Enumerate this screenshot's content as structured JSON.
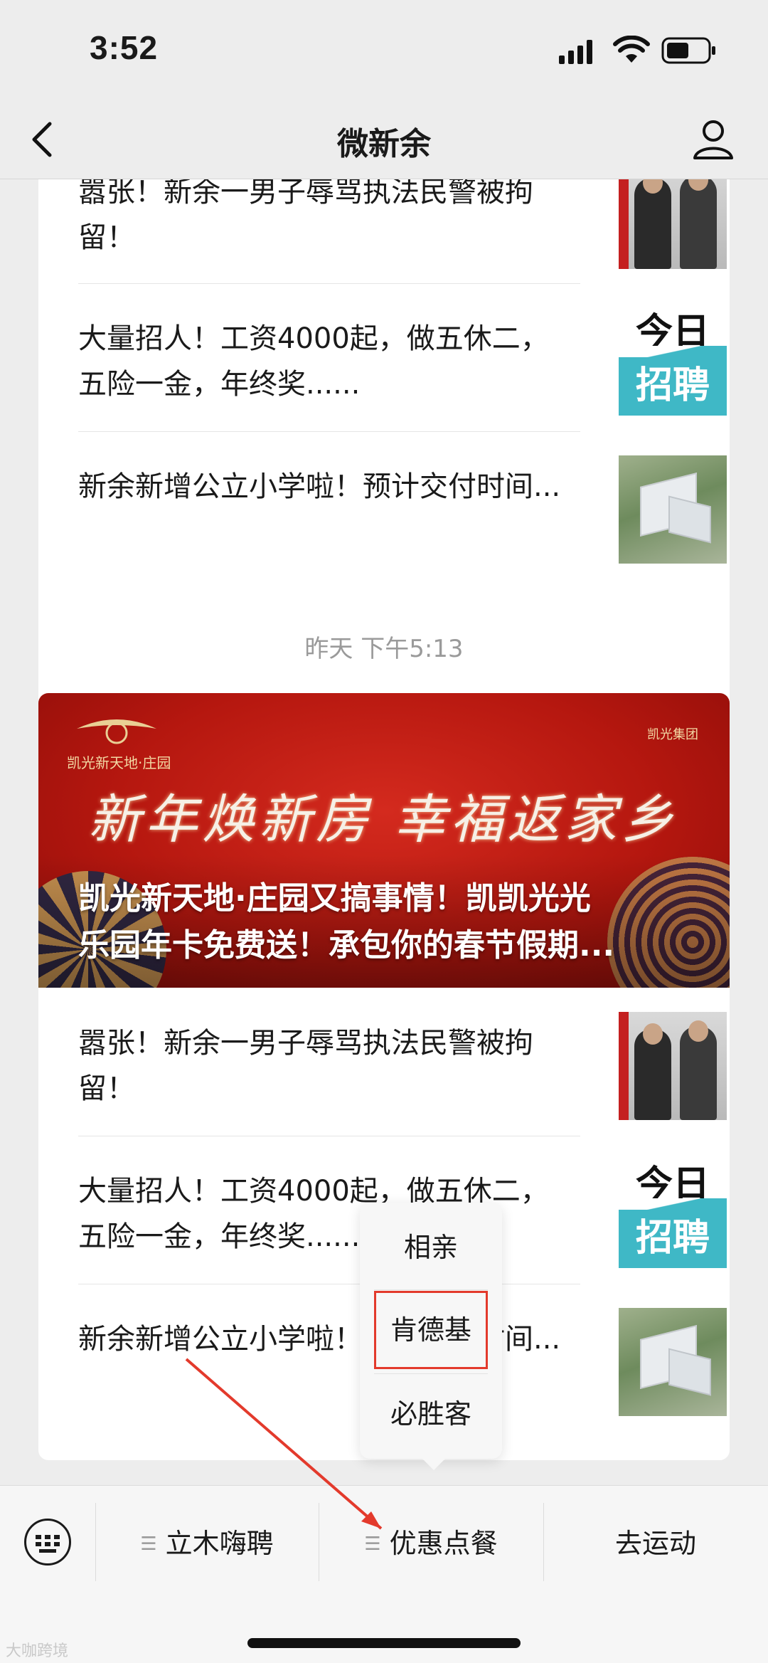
{
  "status_bar": {
    "time": "3:52"
  },
  "nav": {
    "title": "微新余"
  },
  "feed": {
    "card_a": {
      "items": [
        {
          "title": "嚣张！新余一男子辱骂执法民警被拘留！",
          "thumb": "police"
        },
        {
          "title": "大量招人！工资4000起，做五休二，五险一金，年终奖......",
          "thumb": "job"
        },
        {
          "title": "新余新增公立小学啦！预计交付时间...",
          "thumb": "school"
        }
      ]
    },
    "timestamp": "昨天 下午5:13",
    "card_b": {
      "banner": {
        "logo_text": "凯光新天地·庄园",
        "corp_text": "凯光集团",
        "slogan": "新年焕新房 幸福返家乡",
        "headline_line1": "凯光新天地·庄园又搞事情！凯凯光光",
        "headline_line2": "乐园年卡免费送！承包你的春节假期..."
      },
      "items": [
        {
          "title": "嚣张！新余一男子辱骂执法民警被拘留！",
          "thumb": "police"
        },
        {
          "title": "大量招人！工资4000起，做五休二，五险一金，年终奖......",
          "thumb": "job"
        },
        {
          "title": "新余新增公立小学啦！预计交付时间...",
          "thumb": "school"
        }
      ]
    },
    "job_thumb": {
      "top": "今日",
      "bottom": "招聘"
    }
  },
  "popup_menu": {
    "items": [
      "相亲",
      "肯德基",
      "必胜客"
    ],
    "highlighted_index": 1
  },
  "menu_bar": {
    "items": [
      "立木嗨聘",
      "优惠点餐",
      "去运动"
    ]
  },
  "watermark": "大咖跨境",
  "colors": {
    "background": "#ededed",
    "annotation_red": "#e33a2c",
    "job_teal": "#3fb8c6",
    "banner_red": "#b5170f"
  }
}
